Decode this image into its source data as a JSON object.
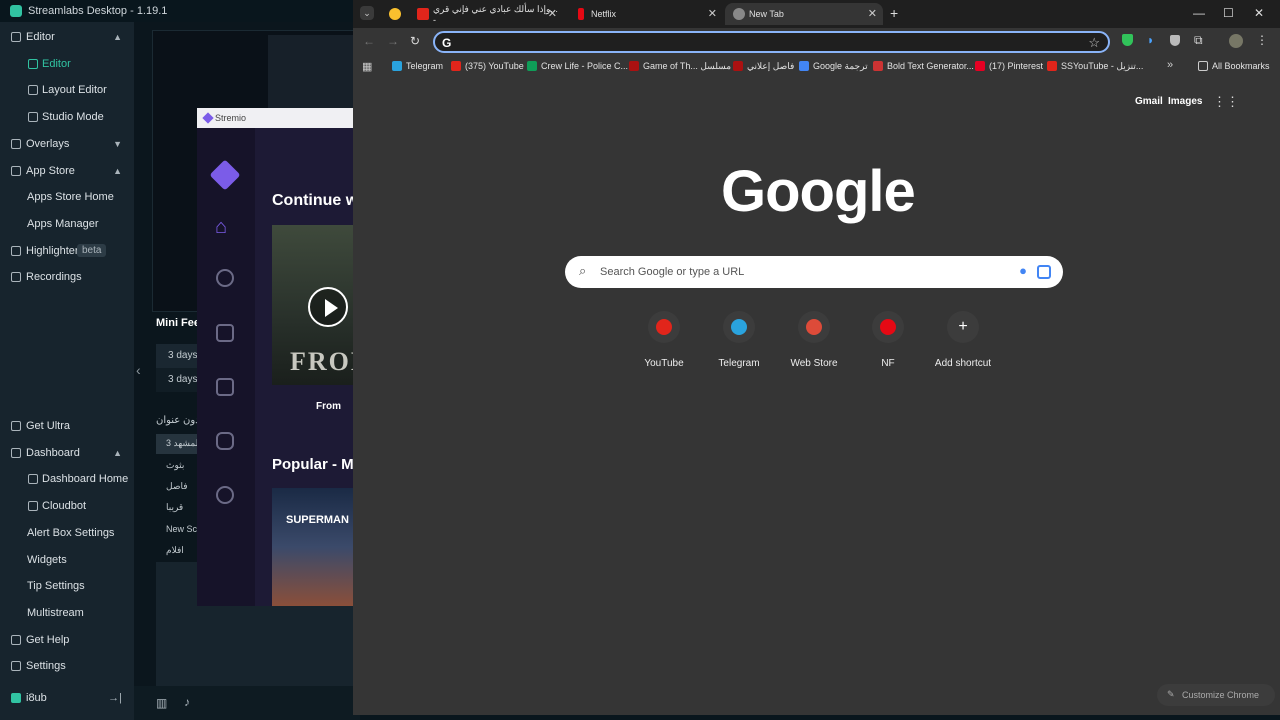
{
  "streamlabs": {
    "title": "Streamlabs Desktop - 1.19.1",
    "sidebar": [
      {
        "label": "Editor",
        "caret": "▲",
        "sub": false,
        "active": false
      },
      {
        "label": "Editor",
        "sub": true,
        "active": true
      },
      {
        "label": "Layout Editor",
        "sub": true,
        "active": false
      },
      {
        "label": "Studio Mode",
        "sub": true,
        "active": false
      },
      {
        "label": "Overlays",
        "caret": "▼",
        "sub": false,
        "active": false
      },
      {
        "label": "App Store",
        "caret": "▲",
        "sub": false,
        "active": false
      },
      {
        "label": "Apps Store Home",
        "sub": true,
        "active": false
      },
      {
        "label": "Apps Manager",
        "sub": true,
        "active": false
      },
      {
        "label": "Highlighter",
        "badge": "beta",
        "sub": false,
        "active": false
      },
      {
        "label": "Recordings",
        "sub": false,
        "active": false
      }
    ],
    "sidebar_bottom": [
      {
        "label": "Get Ultra",
        "sub": false
      },
      {
        "label": "Dashboard",
        "caret": "▲",
        "sub": false
      },
      {
        "label": "Dashboard Home",
        "sub": true
      },
      {
        "label": "Cloudbot",
        "sub": true
      },
      {
        "label": "Alert Box Settings",
        "sub": true
      },
      {
        "label": "Widgets",
        "sub": true
      },
      {
        "label": "Tip Settings",
        "sub": true
      },
      {
        "label": "Multistream",
        "sub": true
      },
      {
        "label": "Get Help",
        "sub": false
      },
      {
        "label": "Settings",
        "sub": false
      }
    ],
    "user": "i8ub",
    "mini_feed": "Mini Fee",
    "feed_rows": [
      "3 days",
      "3 days"
    ],
    "scene_header": "بدون عنوان",
    "scenes": [
      "المشهد 3",
      "بثوث",
      "فاصل",
      "قريبا",
      "New Sc",
      "افلام"
    ]
  },
  "stremio": {
    "title": "Stremio",
    "continue": "Continue w",
    "poster_text": "FRON",
    "from": "From",
    "popular": "Popular - M",
    "poster2_text": "SUPERMAN"
  },
  "chrome": {
    "tabs": [
      {
        "label": "",
        "color": "#f9c02e"
      },
      {
        "label": "وإذا سألك عبادي عني فإني قري... -",
        "color": "#e1251b"
      },
      {
        "label": "Netflix",
        "color": "#e50914"
      },
      {
        "label": "New Tab",
        "color": "#888888"
      }
    ],
    "omnibox": "",
    "bookmarks": [
      {
        "label": "Telegram",
        "color": "#2aa3de"
      },
      {
        "label": "(375) YouTube",
        "color": "#e1251b"
      },
      {
        "label": "Crew Life - Police C...",
        "color": "#0f9d58"
      },
      {
        "label": "Game of Th... مسلسل",
        "color": "#a11"
      },
      {
        "label": "فاصل إعلاني",
        "color": "#a11"
      },
      {
        "label": "Google ترجمة",
        "color": "#4285f4"
      },
      {
        "label": "Bold Text Generator...",
        "color": "#c33"
      },
      {
        "label": "(17) Pinterest",
        "color": "#e60023"
      },
      {
        "label": "SSYouTube - تنزيل...",
        "color": "#e1251b"
      }
    ],
    "all_bookmarks": "All Bookmarks",
    "gmail": "Gmail",
    "images": "Images",
    "logo": "Google",
    "search_placeholder": "Search Google or type a URL",
    "shortcuts": [
      {
        "label": "YouTube",
        "color": "#e1251b"
      },
      {
        "label": "Telegram",
        "color": "#2aa3de"
      },
      {
        "label": "Web Store",
        "color": "#dd4b39"
      },
      {
        "label": "NF",
        "color": "#e50914"
      },
      {
        "label": "Add shortcut",
        "color": "#3c3c3c"
      }
    ],
    "customize": "Customize Chrome"
  }
}
